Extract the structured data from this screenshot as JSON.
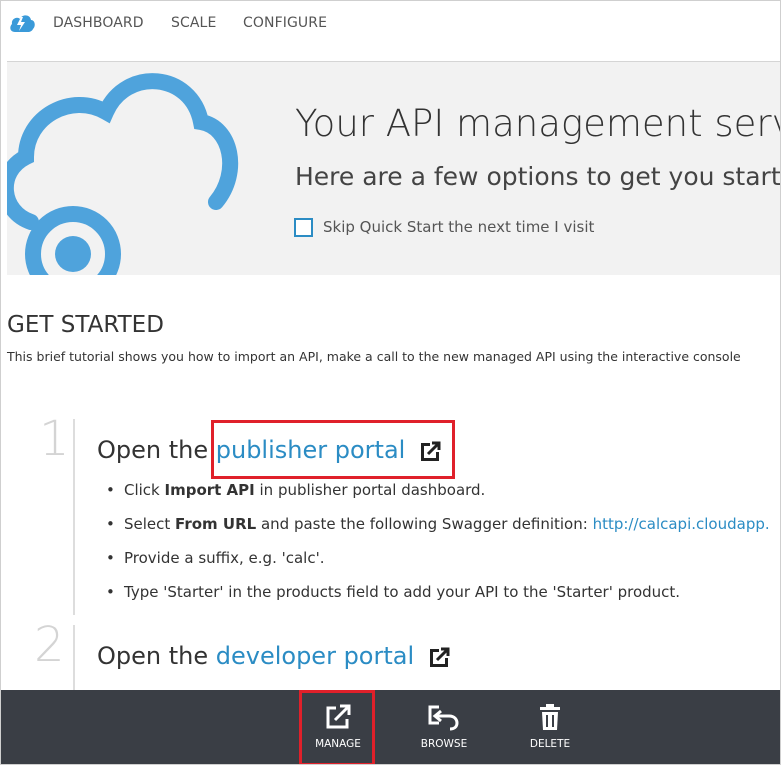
{
  "nav": {
    "items": [
      "DASHBOARD",
      "SCALE",
      "CONFIGURE"
    ]
  },
  "hero": {
    "title": "Your API management service",
    "subtitle": "Here are a few options to get you started",
    "skip_label": "Skip Quick Start the next time I visit",
    "skip_checked": false
  },
  "get_started": {
    "title": "GET STARTED",
    "description": "This brief tutorial shows you how to import an API, make a call to the new managed API using the interactive console"
  },
  "steps": [
    {
      "number": "1",
      "prefix": "Open the ",
      "link": "publisher portal",
      "bullets": [
        {
          "pre": "Click ",
          "bold": "Import API",
          "post": " in publisher portal dashboard."
        },
        {
          "pre": "Select ",
          "bold": "From URL",
          "post": " and paste the following Swagger definition: ",
          "url": "http://calcapi.cloudapp."
        },
        {
          "pre": "Provide a suffix, e.g. 'calc'.",
          "bold": "",
          "post": ""
        },
        {
          "pre": "Type 'Starter' in the products field to add your API to the 'Starter' product.",
          "bold": "",
          "post": ""
        }
      ]
    },
    {
      "number": "2",
      "prefix": "Open the ",
      "link": "developer portal",
      "bullets": []
    }
  ],
  "commands": [
    {
      "label": "MANAGE",
      "icon": "external-link-icon"
    },
    {
      "label": "BROWSE",
      "icon": "browse-icon"
    },
    {
      "label": "DELETE",
      "icon": "trash-icon"
    }
  ],
  "colors": {
    "accent": "#2b8cc4",
    "highlight": "#e0202a",
    "command_bar": "#3a3e45",
    "hero_bg": "#f2f2f2"
  }
}
